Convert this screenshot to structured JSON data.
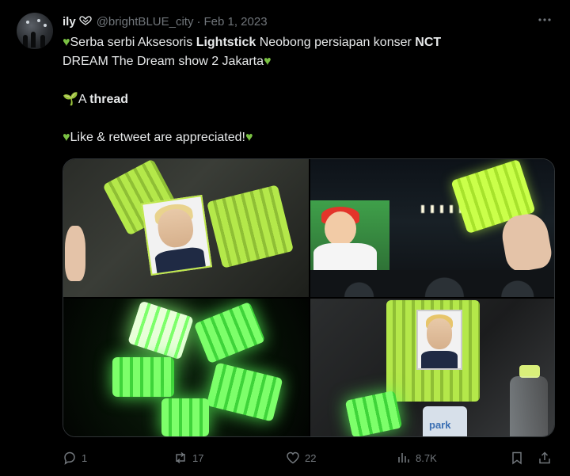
{
  "author": {
    "display_name": "ily",
    "handle": "@brightBLUE_city",
    "separator": "·",
    "date": "Feb 1, 2023"
  },
  "tweet": {
    "line1_prefix": "Serba serbi Aksesoris ",
    "line1_bold": "Lightstick",
    "line1_mid": " Neobong persiapan konser ",
    "line1_bold2": "NCT",
    "line2": "DREAM The Dream show 2 Jakarta",
    "line3_prefix": "A ",
    "line3_bold": "thread",
    "line4": "Like & retweet are appreciated!"
  },
  "media": {
    "photos": [
      "photo-1",
      "photo-2",
      "photo-3",
      "photo-4"
    ],
    "bottle_label": "park"
  },
  "actions": {
    "reply_count": "1",
    "retweet_count": "17",
    "like_count": "22",
    "views_count": "8.7K"
  },
  "colors": {
    "background": "#000000",
    "text": "#e7e9ea",
    "muted": "#71767b",
    "lightstick_green": "#caff4a"
  }
}
